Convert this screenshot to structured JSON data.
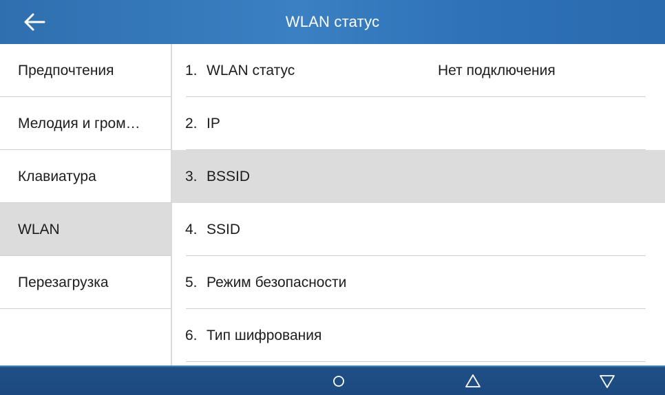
{
  "header": {
    "title": "WLAN статус",
    "back_icon": "arrow-left-icon"
  },
  "sidebar": {
    "items": [
      {
        "label": "Предпочтения",
        "active": false
      },
      {
        "label": "Мелодия и гром…",
        "active": false
      },
      {
        "label": "Клавиатура",
        "active": false
      },
      {
        "label": "WLAN",
        "active": true
      },
      {
        "label": "Перезагрузка",
        "active": false
      }
    ]
  },
  "main": {
    "rows": [
      {
        "num": "1.",
        "label": "WLAN статус",
        "value": "Нет подключения",
        "selected": false
      },
      {
        "num": "2.",
        "label": "IP",
        "value": "",
        "selected": false
      },
      {
        "num": "3.",
        "label": "BSSID",
        "value": "",
        "selected": true
      },
      {
        "num": "4.",
        "label": "SSID",
        "value": "",
        "selected": false
      },
      {
        "num": "5.",
        "label": "Режим безопасности",
        "value": "",
        "selected": false
      },
      {
        "num": "6.",
        "label": "Тип шифрования",
        "value": "",
        "selected": false
      }
    ]
  },
  "navbar": {
    "buttons": [
      "home-circle-icon",
      "back-triangle-up-icon",
      "menu-triangle-down-icon"
    ]
  },
  "colors": {
    "header": "#3a80c2",
    "navbar": "#1c4a80",
    "selected_bg": "#dcdcdc"
  }
}
